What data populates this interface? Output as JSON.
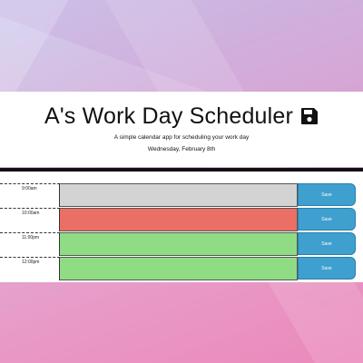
{
  "header": {
    "title": "A's Work Day Scheduler",
    "lead": "A simple calendar app for scheduling your work day",
    "date": "Wednesday, February 8th"
  },
  "icons": {
    "title_icon": "floppy-disk-save-icon"
  },
  "colors": {
    "past": "#d3d3d3",
    "present": "#ea6f64",
    "future": "#8fdc85",
    "save_button": "#3fa0cf"
  },
  "rows": [
    {
      "hour": "9:00am",
      "status": "past",
      "save_label": "Save"
    },
    {
      "hour": "10:00am",
      "status": "present",
      "save_label": "Save"
    },
    {
      "hour": "11:00pm",
      "status": "future",
      "save_label": "Save"
    },
    {
      "hour": "12:00pm",
      "status": "future",
      "save_label": "Save"
    }
  ]
}
